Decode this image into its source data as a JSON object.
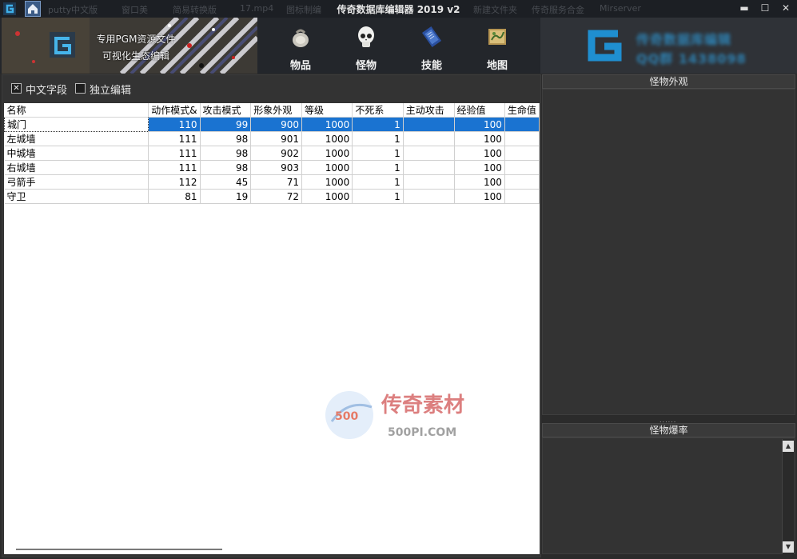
{
  "window": {
    "title": "传奇数据库编辑器 2019 v2",
    "taskbar_ghost_items": [
      "putty中文版",
      "窗口美",
      "简易转换版",
      "17.mp4",
      "图标制编",
      "新建文件夹",
      "传奇服务合金",
      "Mirserver"
    ]
  },
  "banner": {
    "line1": "专用PGM资源文件",
    "line2": "可视化生态编辑"
  },
  "nav": {
    "items": [
      {
        "label": "物品",
        "icon": "bag-icon"
      },
      {
        "label": "怪物",
        "icon": "skull-icon"
      },
      {
        "label": "技能",
        "icon": "book-icon"
      },
      {
        "label": "地图",
        "icon": "map-icon"
      }
    ]
  },
  "brand": {
    "blur_line1": "传奇数据库编辑",
    "blur_line2": "QQ群 1438098"
  },
  "options": {
    "chinese_fields_label": "中文字段",
    "chinese_fields_checked": true,
    "independent_edit_label": "独立编辑",
    "independent_edit_checked": false
  },
  "grid": {
    "columns": [
      "名称",
      "动作模式&",
      "攻击模式",
      "形象外观",
      "等级",
      "不死系",
      "主动攻击",
      "经验值",
      "生命值"
    ],
    "rows": [
      [
        "城门",
        "110",
        "99",
        "900",
        "1000",
        "1",
        "",
        "100",
        ""
      ],
      [
        "左城墙",
        "111",
        "98",
        "901",
        "1000",
        "1",
        "",
        "100",
        ""
      ],
      [
        "中城墙",
        "111",
        "98",
        "902",
        "1000",
        "1",
        "",
        "100",
        ""
      ],
      [
        "右城墙",
        "111",
        "98",
        "903",
        "1000",
        "1",
        "",
        "100",
        ""
      ],
      [
        "弓箭手",
        "112",
        "45",
        "71",
        "1000",
        "1",
        "",
        "100",
        ""
      ],
      [
        "守卫",
        "81",
        "19",
        "72",
        "1000",
        "1",
        "",
        "100",
        ""
      ]
    ],
    "selected_row": 0
  },
  "right": {
    "appearance_title": "怪物外观",
    "droprate_title": "怪物爆率",
    "splitter_dots": "......"
  },
  "watermark": {
    "text_cn": "传奇素材",
    "text_en": "500PI.COM",
    "badge": "500"
  },
  "colors": {
    "selection": "#1a73d1",
    "brand_logo": "#1f8fd0",
    "panel_bg": "#333333"
  }
}
